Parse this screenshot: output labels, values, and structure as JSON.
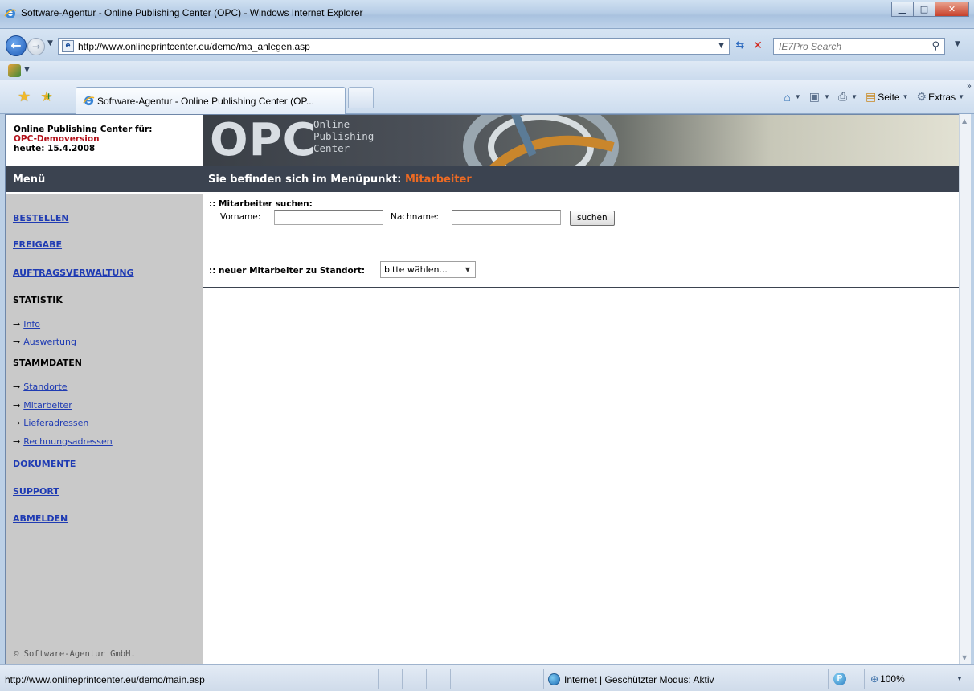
{
  "window": {
    "title": "Software-Agentur - Online Publishing Center (OPC) - Windows Internet Explorer",
    "minimize_glyph": "▁",
    "maximize_glyph": "□",
    "close_glyph": "✕"
  },
  "address_bar": {
    "url": "http://www.onlineprintcenter.eu/demo/ma_anlegen.asp",
    "search_placeholder": "IE7Pro Search",
    "page_icon_glyph": "e",
    "icons": [
      "back-arrow-icon",
      "forward-arrow-icon",
      "refresh-icon",
      "stop-icon",
      "search-icon"
    ]
  },
  "tabs": [
    {
      "label": "Software-Agentur - Online Publishing Center (OP..."
    }
  ],
  "command_bar": {
    "page_label": "Seite",
    "extras_label": "Extras"
  },
  "page": {
    "header": {
      "center_label": "Online Publishing Center für:",
      "customer": "OPC-Demoversion",
      "date_line": "heute: 15.4.2008",
      "logo_text": "OPC",
      "logo_tagline": [
        "Online",
        "Publishing",
        "Center"
      ]
    },
    "menu_title": "Menü",
    "breadcrumb_prefix": "Sie befinden sich im Menüpunkt:",
    "breadcrumb_current": "Mitarbeiter",
    "sidebar": {
      "bestellen": "BESTELLEN",
      "freigabe": "FREIGABE",
      "auftragsverwaltung": "AUFTRAGSVERWALTUNG",
      "statistik": "STATISTIK",
      "info": "Info",
      "auswertung": "Auswertung",
      "stammdaten": "STAMMDATEN",
      "standorte": "Standorte",
      "mitarbeiter": "Mitarbeiter",
      "lieferadressen": "Lieferadressen",
      "rechnungsadressen": "Rechnungsadressen",
      "dokumente": "DOKUMENTE",
      "support": "SUPPORT",
      "abmelden": "ABMELDEN",
      "arrow": "→",
      "copyright": "© Software-Agentur GmbH."
    },
    "search": {
      "title": ":: Mitarbeiter suchen:",
      "first_name_label": "Vorname:",
      "first_name_value": "",
      "last_name_label": "Nachname:",
      "last_name_value": "",
      "button_label": "suchen"
    },
    "new_employee": {
      "label": ":: neuer Mitarbeiter zu Standort:",
      "selected": "bitte wählen..."
    }
  },
  "status_bar": {
    "text": "http://www.onlineprintcenter.eu/demo/main.asp",
    "zone": "Internet | Geschützter Modus: Aktiv",
    "zoom": "100%"
  },
  "colors": {
    "menu_bar_bg": "#3b4350",
    "sidebar_bg": "#c9c9c9",
    "link": "#1f3bb3",
    "accent_orange": "#ec6a23",
    "demo_red": "#b3121b"
  }
}
